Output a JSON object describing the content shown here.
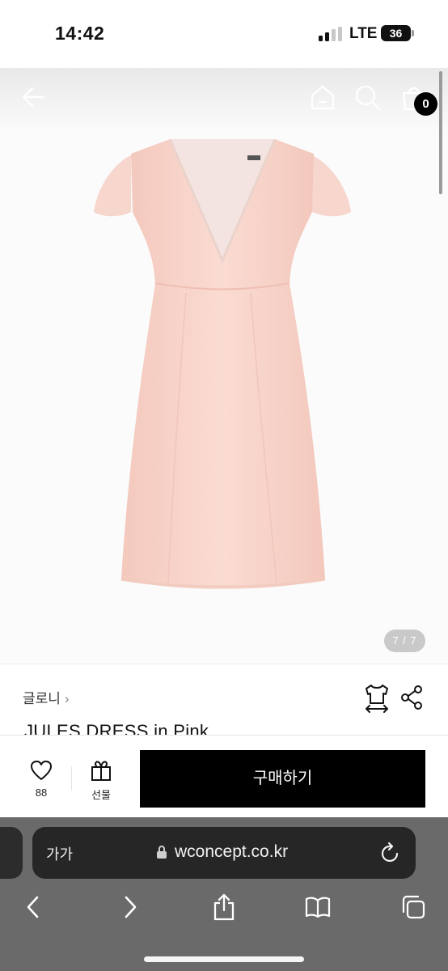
{
  "status_bar": {
    "time": "14:42",
    "network": "LTE",
    "battery": "36"
  },
  "product_image": {
    "cart_count": "0",
    "page_indicator": "7 / 7",
    "icons": [
      "back-arrow-icon",
      "home-icon",
      "search-icon",
      "cart-icon"
    ]
  },
  "product": {
    "brand": "글로니",
    "brand_chevron": "›",
    "title": "JULES DRESS in Pink",
    "colors": {
      "dress": "#f7d3c8",
      "accent": "#000000"
    }
  },
  "purchase_bar": {
    "like_count": "88",
    "gift_label": "선물",
    "buy_label": "구매하기"
  },
  "browser": {
    "text_size_label": "가가",
    "url": "wconcept.co.kr"
  }
}
